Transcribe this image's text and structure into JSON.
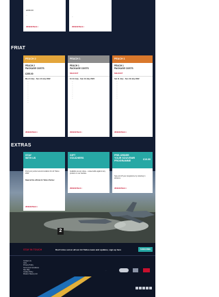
{
  "top_cards": [
    {
      "price": "£396.00",
      "text": "...",
      "link": "VIEW DETAILS >"
    },
    {
      "text": "...",
      "link": "VIEW DETAILS >"
    }
  ],
  "friat": {
    "title": "FRIAT",
    "tabs": [
      {
        "label": "PEACH 2",
        "color": "#e3a53b"
      },
      {
        "label": "PEACH 1",
        "color": "#8c8c8c"
      },
      {
        "label": "PEACH 1",
        "color": "#d9782c"
      }
    ],
    "packs": [
      {
        "name": "PEACH 2\nPACKAGE COSTS",
        "price": "£295.00",
        "date": "Mon 8 July - Sun 14 July 2022",
        "bullets": [
          "...",
          "...",
          "...",
          "...",
          "...",
          "...",
          "...",
          "...",
          "...",
          "...",
          "..."
        ],
        "link": "VIEW DETAILS >"
      },
      {
        "name": "PEACH 1\nPACKAGE COSTS",
        "price": "",
        "buy": "SOLD OUT",
        "date": "Fri 10 July - Sun 19 July 2022",
        "bullets": [
          "...",
          "...",
          "...",
          "...",
          "...",
          "...",
          "...",
          "...",
          "..."
        ],
        "link": "VIEW DETAILS >"
      },
      {
        "name": "PEACH 1\nPACKAGE COSTS",
        "price": "",
        "buy": "SOLD OUT",
        "date": "Sat 11 July - Sun 19 July 2022",
        "bullets": [
          "...",
          "...",
          "...",
          "...",
          "...",
          "...",
          "...",
          "...",
          "..."
        ],
        "link": "VIEW DETAILS >"
      }
    ]
  },
  "extras": {
    "title": "EXTRAS",
    "cards": [
      {
        "head": "STAY\nWITH US",
        "price": "",
        "body1": "Find your perfect accommodation for Air Tattoo 2022",
        "body2": "Read all the official Air Tattoo Partner",
        "link": "VIEW DETAILS >"
      },
      {
        "head": "GIFT\nVOUCHERS",
        "price": "",
        "body1": "Available as any value – redeemable against any product on our website",
        "body2": "",
        "link": "VIEW DETAILS >"
      },
      {
        "head": "PRE-ORDER\nYOUR SOUVENIR\nPROGRAMME",
        "price": "£10.00",
        "body1": "",
        "body2": "Save £2 off your programme by ordering in advance",
        "link": "VIEW DETAILS >"
      }
    ]
  },
  "hero": {
    "badge_number": "2"
  },
  "newsletter": {
    "heading": "STAY IN TOUCH",
    "text": "Don't miss out on all our Air Tattoo news and updates, sign up here",
    "button": "SUBSCRIBE"
  },
  "footer": {
    "links": [
      "Contact Us",
      "Jobs",
      "Privacy Policy",
      "Terms and Conditions",
      "Site Map",
      "Cookie Policy",
      "Modern Slavery Act"
    ],
    "legal": "...",
    "social_icons": [
      "facebook-icon",
      "twitter-icon",
      "youtube-icon",
      "instagram-icon",
      "linkedin-icon"
    ]
  },
  "colors": {
    "navy": "#131d33",
    "teal": "#27a8a5",
    "red": "#c8102e"
  }
}
